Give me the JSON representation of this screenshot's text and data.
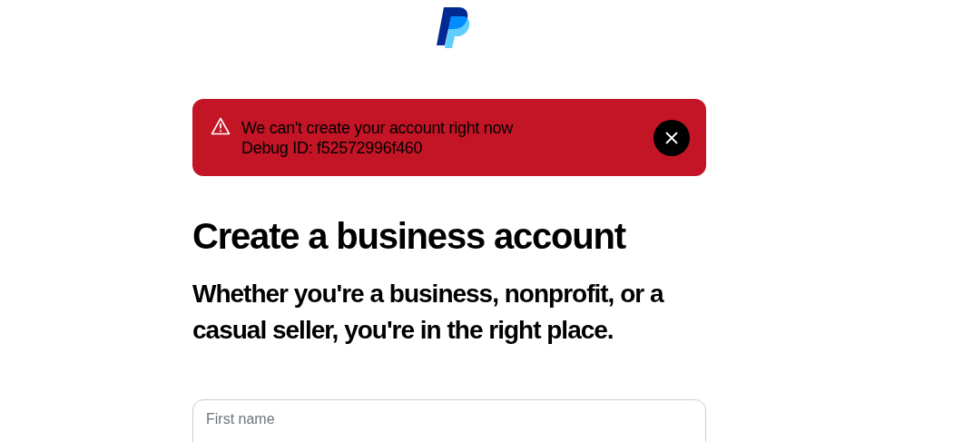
{
  "alert": {
    "kind": "error",
    "lines": [
      "We can't create your account right now",
      "Debug ID: f52572996f460"
    ]
  },
  "heading": "Create a business account",
  "subheading": "Whether you're a business, nonprofit, or a casual seller, you're in the right place.",
  "fields": [
    {
      "label": "First name"
    }
  ]
}
